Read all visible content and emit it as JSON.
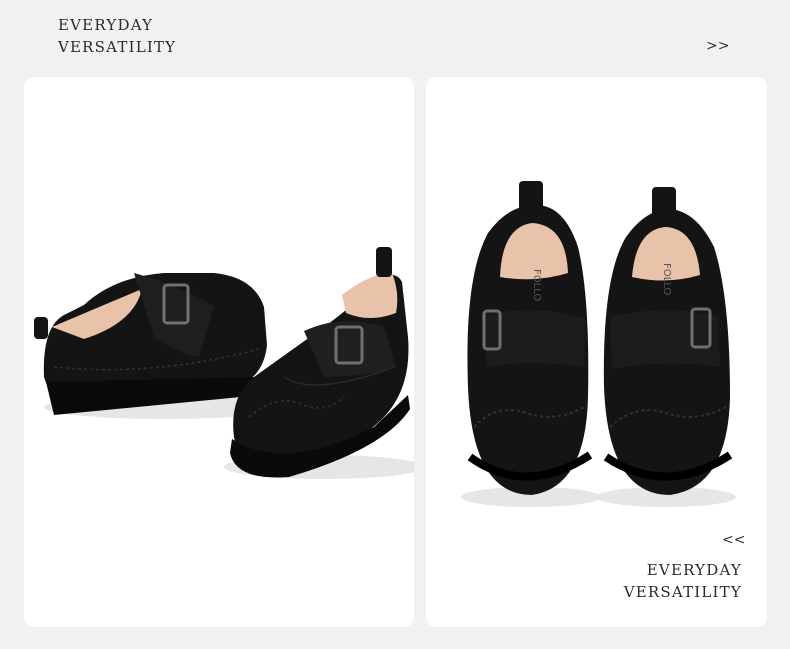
{
  "header": {
    "line1": "EVERYDAY",
    "line2": "VERSATILITY",
    "next_label": ">>"
  },
  "footer": {
    "prev_label": "<<",
    "line1": "EVERYDAY",
    "line2": "VERSATILITY"
  },
  "product": {
    "brand_on_insole": "FOLLO"
  },
  "colors": {
    "page_bg": "#f1f1f1",
    "card_bg": "#ffffff",
    "leather": "#141414",
    "lining": "#e8c3aa",
    "text": "#2b2b2b"
  }
}
